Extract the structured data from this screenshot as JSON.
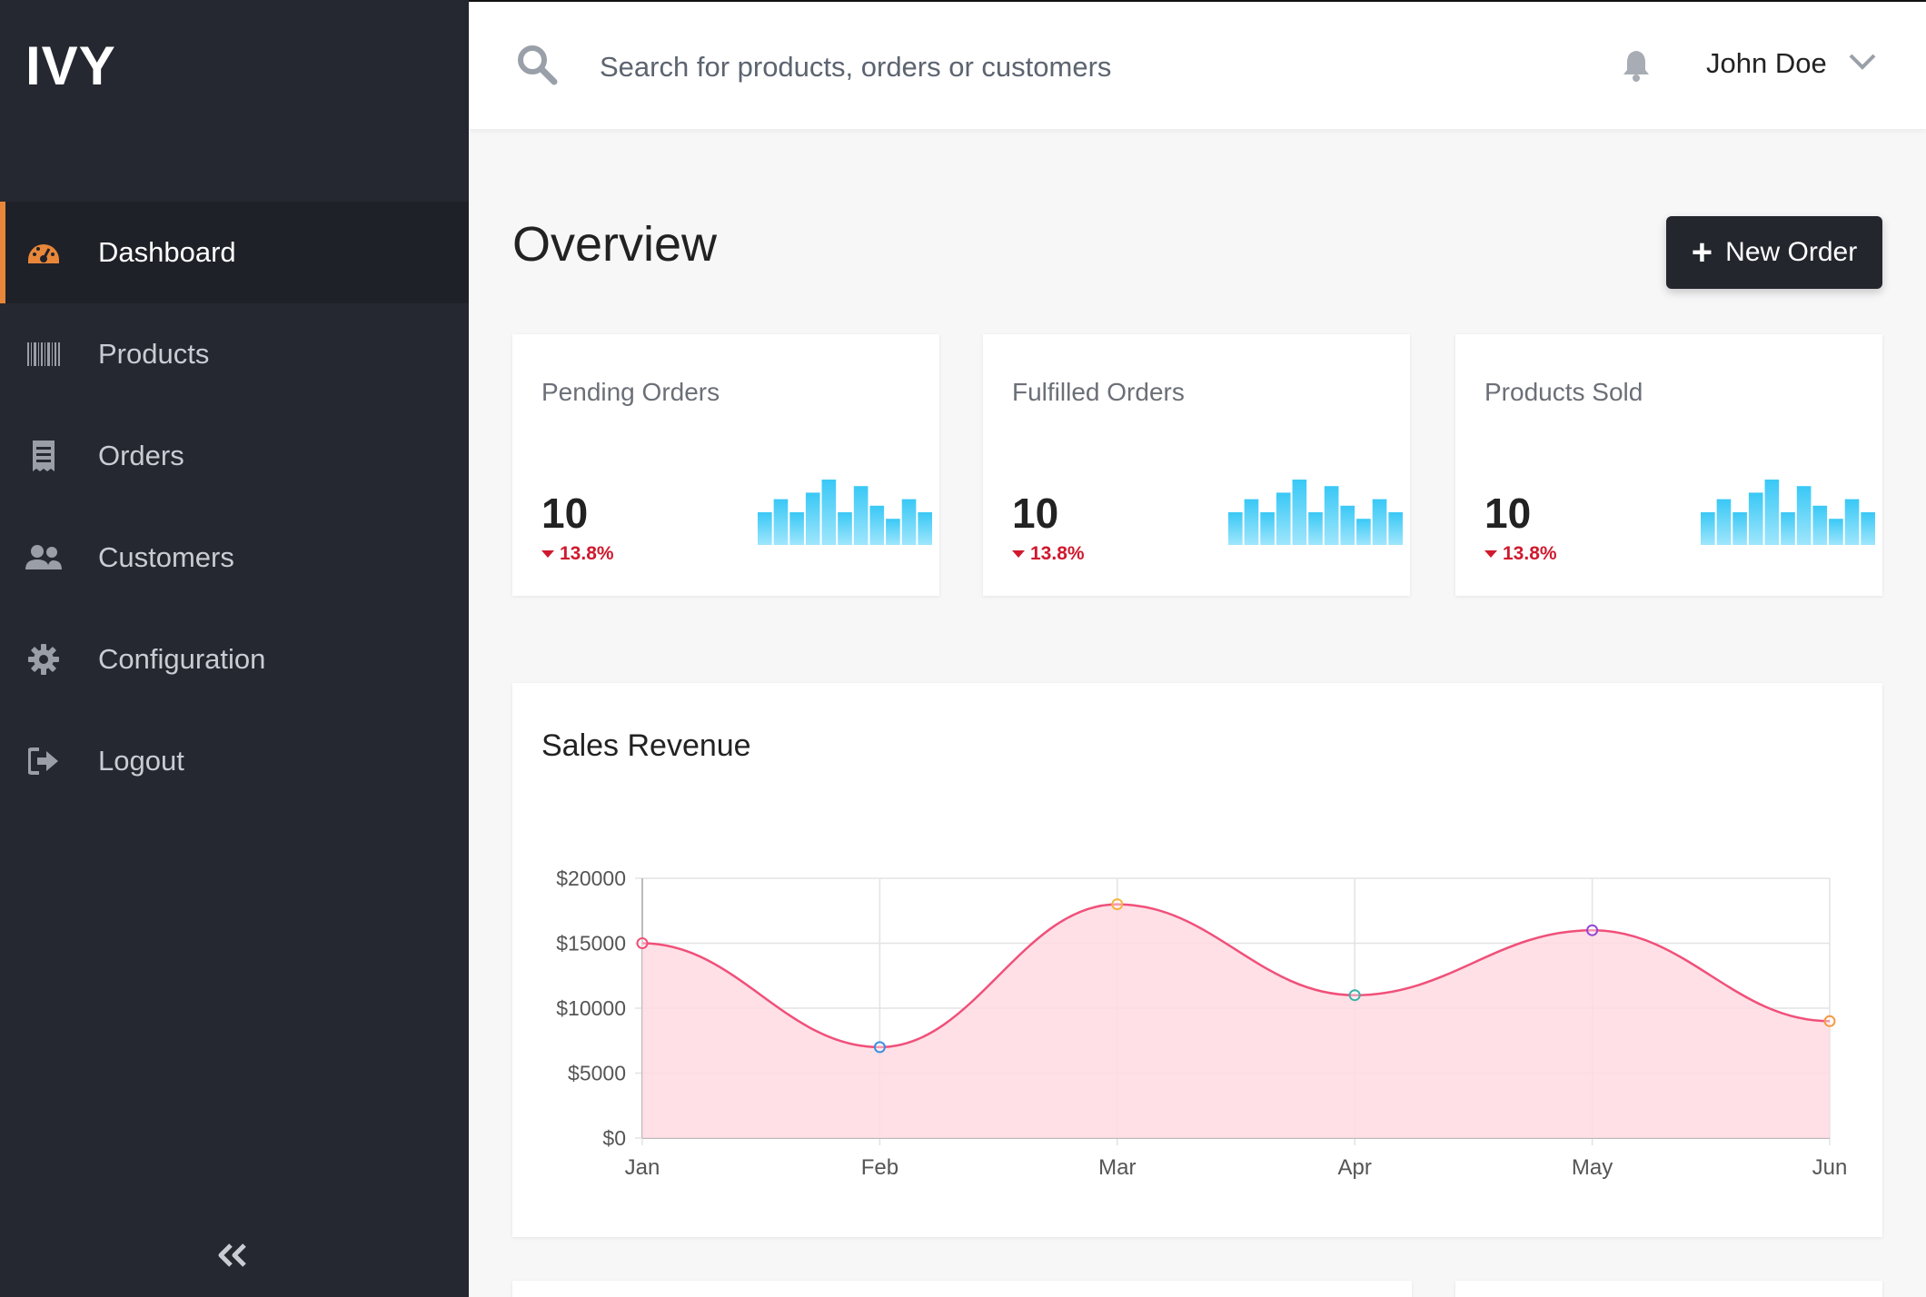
{
  "app": {
    "logo": "IVY"
  },
  "sidebar": {
    "items": [
      {
        "label": "Dashboard",
        "icon": "dashboard-icon",
        "active": true
      },
      {
        "label": "Products",
        "icon": "barcode-icon",
        "active": false
      },
      {
        "label": "Orders",
        "icon": "receipt-icon",
        "active": false
      },
      {
        "label": "Customers",
        "icon": "users-icon",
        "active": false
      },
      {
        "label": "Configuration",
        "icon": "gear-icon",
        "active": false
      },
      {
        "label": "Logout",
        "icon": "logout-icon",
        "active": false
      }
    ],
    "collapse_icon": "double-chevron-left-icon"
  },
  "topbar": {
    "search_placeholder": "Search for products, orders or customers",
    "user_name": "John Doe"
  },
  "main": {
    "title": "Overview",
    "new_order_label": "New Order"
  },
  "cards": [
    {
      "title": "Pending Orders",
      "value": "10",
      "delta": "13.8%",
      "spark": [
        5,
        7,
        5,
        8,
        10,
        5,
        9,
        6,
        4,
        7,
        5
      ]
    },
    {
      "title": "Fulfilled Orders",
      "value": "10",
      "delta": "13.8%",
      "spark": [
        5,
        7,
        5,
        8,
        10,
        5,
        9,
        6,
        4,
        7,
        5
      ]
    },
    {
      "title": "Products Sold",
      "value": "10",
      "delta": "13.8%",
      "spark": [
        5,
        7,
        5,
        8,
        10,
        5,
        9,
        6,
        4,
        7,
        5
      ]
    }
  ],
  "colors": {
    "accent": "#e8873a",
    "sidebar_bg": "#252830",
    "delta_negative": "#d0192e",
    "spark_top": "#39c8f6",
    "spark_bottom": "#9fe6fc",
    "line": "#f0507a",
    "area": "#ffdae2"
  },
  "revenue": {
    "title": "Sales Revenue"
  },
  "chart_data": {
    "type": "area",
    "title": "Sales Revenue",
    "categories": [
      "Jan",
      "Feb",
      "Mar",
      "Apr",
      "May",
      "Jun"
    ],
    "series": [
      {
        "values": [
          15000,
          7000,
          18000,
          11000,
          16000,
          9000
        ]
      }
    ],
    "point_colors": [
      "#f0507a",
      "#3b8fe0",
      "#f5b342",
      "#3bb3a8",
      "#9146d9",
      "#f59a42"
    ],
    "y_ticks": [
      "$0",
      "$5000",
      "$10000",
      "$15000",
      "$20000"
    ],
    "ylim": [
      0,
      20000
    ],
    "grid": true
  }
}
